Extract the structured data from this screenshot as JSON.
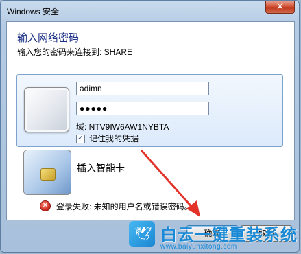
{
  "window": {
    "title": "Windows 安全",
    "close_label": "✕"
  },
  "dialog": {
    "heading": "输入网络密码",
    "subheading": "输入您的密码来连接到: SHARE"
  },
  "credential": {
    "username": "adimn",
    "password_mask": "●●●●●",
    "domain": "域: NTV9IW6AW1NYBTA",
    "remember_label": "记住我的凭据",
    "remember_checked": true
  },
  "smartcard": {
    "label": "插入智能卡"
  },
  "error": {
    "icon": "error-x-icon",
    "message": "登录失败: 未知的用户名或错误密码。"
  },
  "buttons": {
    "ok": "确定",
    "cancel": "取消"
  },
  "watermark": {
    "title": "白云一键重装系统",
    "url": "www.baiyunxitong.com"
  },
  "colors": {
    "heading": "#1e3287",
    "arrow": "#e2322a",
    "watermark": "#1a8ad6"
  }
}
